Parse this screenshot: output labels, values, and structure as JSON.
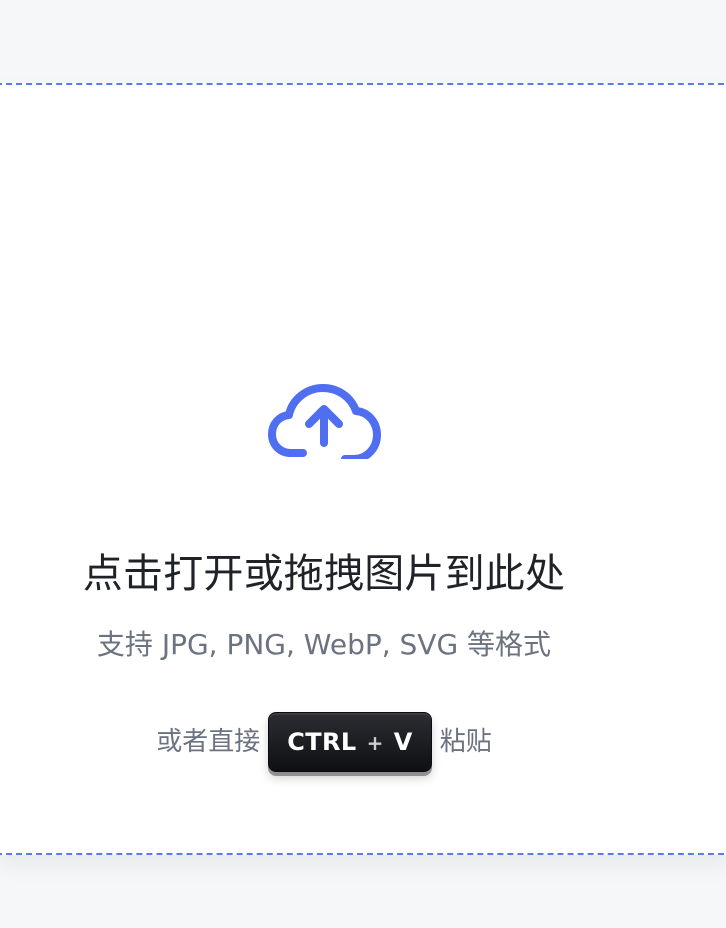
{
  "dropzone": {
    "title": "点击打开或拖拽图片到此处",
    "subtitle": "支持 JPG, PNG, WebP, SVG 等格式",
    "paste": {
      "prefix": "或者直接",
      "key_left": "CTRL",
      "key_plus": "+",
      "key_right": "V",
      "suffix": "粘贴"
    },
    "icon": "upload-cloud-icon",
    "colors": {
      "accent": "#4f6ff0",
      "border": "#5b79f0",
      "background": "#ffffff",
      "page_background": "#f6f7f9",
      "title_text": "#1f2328",
      "muted_text": "#6b7280",
      "keycap": "#111215"
    }
  }
}
